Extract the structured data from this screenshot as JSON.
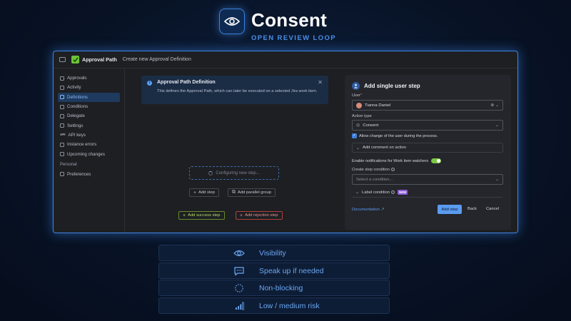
{
  "hero": {
    "title": "Consent",
    "subtitle": "OPEN REVIEW LOOP",
    "icon": "eye-icon"
  },
  "app": {
    "name": "Approval Path",
    "breadcrumb": "Create new Approval Definition",
    "sidebar": {
      "items": [
        {
          "label": "Approvals",
          "icon": "approvals-icon"
        },
        {
          "label": "Activity",
          "icon": "activity-icon"
        },
        {
          "label": "Definitions",
          "icon": "definitions-icon",
          "active": true
        },
        {
          "label": "Conditions",
          "icon": "conditions-icon"
        },
        {
          "label": "Delegate",
          "icon": "delegate-icon"
        },
        {
          "label": "Settings",
          "icon": "settings-icon"
        },
        {
          "label": "API keys",
          "icon": "api-icon",
          "icon_text": "API"
        },
        {
          "label": "Instance errors",
          "icon": "errors-icon"
        },
        {
          "label": "Upcoming changes",
          "icon": "changes-icon"
        }
      ],
      "section_personal": "Personal",
      "personal_items": [
        {
          "label": "Preferences",
          "icon": "preferences-icon"
        }
      ]
    },
    "banner": {
      "title": "Approval Path Definition",
      "description": "This defines the Approval Path, which can later be executed on a selected Jira work item."
    },
    "canvas": {
      "placeholder": "Configuring new step...",
      "add_step": "Add step",
      "add_parallel_group": "Add parallel group",
      "add_success_step": "Add success step",
      "add_rejection_step": "Add rejection step"
    },
    "panel": {
      "title": "Add single user step",
      "user_label": "User",
      "user_required": "*",
      "user_value": "Tianna Daniel",
      "action_type_label": "Action type",
      "action_type_value": "Consent",
      "allow_change_label": "Allow change of the user during the process.",
      "allow_change_checked": true,
      "add_comment_label": "Add comment on action",
      "notifications_label": "Enable notifications for Work item watchers",
      "notifications_on": true,
      "create_condition_label": "Create step condition",
      "condition_placeholder": "Select a condition...",
      "label_condition": "Label condition",
      "label_condition_badge": "NEW",
      "documentation": "Documentation ↗",
      "add_step_button": "Add step",
      "back_button": "Back",
      "cancel_button": "Cancel"
    }
  },
  "features": [
    {
      "label": "Visibility",
      "icon": "eye-icon"
    },
    {
      "label": "Speak up if needed",
      "icon": "chat-bubble-icon"
    },
    {
      "label": "Non-blocking",
      "icon": "dashed-circle-icon"
    },
    {
      "label": "Low / medium risk",
      "icon": "signal-bars-icon"
    }
  ],
  "colors": {
    "accent": "#3f86e8",
    "feature_text": "#6aa7f2",
    "success": "#b7dd66",
    "reject": "#f0918b",
    "primary_button": "#5b9bf0"
  }
}
